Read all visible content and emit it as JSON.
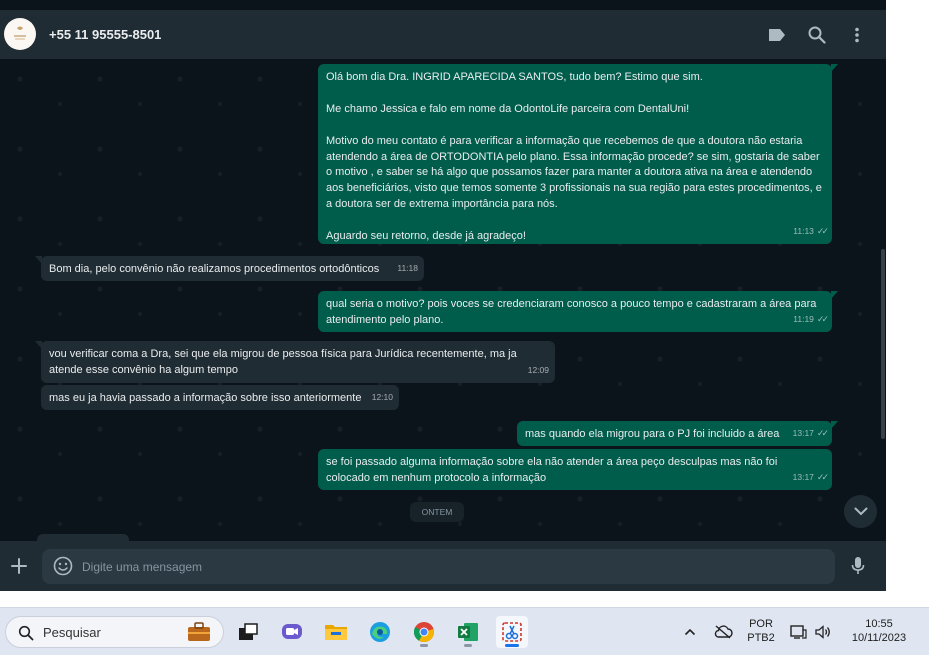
{
  "header": {
    "contact_name": "+55 11 95555-8501",
    "avatar_icon": "clinic-logo-avatar",
    "icons": [
      "label-icon",
      "search-icon",
      "more-vertical-icon"
    ]
  },
  "messages": [
    {
      "direction": "out",
      "text": "Olá bom dia Dra.  INGRID APARECIDA SANTOS, tudo bem? Estimo que sim.\n\nMe chamo Jessica e falo em nome da OdontoLife parceira com DentalUni!\n\nMotivo do meu contato é para verificar a informação que recebemos de que a doutora não estaria atendendo a área de ORTODONTIA pelo plano. Essa informação procede? se sim, gostaria de saber o motivo , e saber se há algo que possamos fazer para manter a doutora ativa na área e atendendo aos beneficiários, visto que temos somente 3 profissionais na sua região para estes procedimentos, e a doutora ser de extrema importância para nós.\n\nAguardo seu retorno, desde já agradeço!",
      "time": "11:13"
    },
    {
      "direction": "in",
      "text": "Bom dia, pelo convênio não realizamos procedimentos ortodônticos",
      "time": "11:18"
    },
    {
      "direction": "out",
      "text": "qual seria o motivo? pois voces se credenciaram conosco a pouco tempo e cadastraram a área para atendimento pelo plano.",
      "time": "11:19"
    },
    {
      "direction": "in",
      "text": "vou verificar coma a Dra, sei que ela migrou de pessoa física para Jurídica recentemente, ma ja atende esse convênio ha algum tempo",
      "time": "12:09"
    },
    {
      "direction": "in",
      "text": "mas eu ja havia passado a informação sobre isso anteriormente",
      "time": "12:10"
    },
    {
      "direction": "out",
      "text": "mas quando ela migrou para o PJ foi incluido a área",
      "time": "13:17"
    },
    {
      "direction": "out",
      "text": "se foi passado alguma informação sobre ela não atender a área peço desculpas mas não foi colocado em nenhum protocolo a informação",
      "time": "13:17"
    }
  ],
  "day_separator": "ONTEM",
  "composer": {
    "placeholder": "Digite uma mensagem"
  },
  "taskbar": {
    "search_placeholder": "Pesquisar",
    "apps": [
      "briefcase-icon",
      "task-view-icon",
      "meet-icon",
      "file-explorer-icon",
      "edge-icon",
      "chrome-icon",
      "excel-icon",
      "snipping-tool-icon"
    ],
    "lang_top": "POR",
    "lang_bottom": "PTB2",
    "time": "10:55",
    "date": "10/11/2023"
  },
  "colors": {
    "outgoing_bubble": "#005c4b",
    "incoming_bubble": "#202c33",
    "chat_background": "#0b141a",
    "header_background": "#202c33"
  }
}
